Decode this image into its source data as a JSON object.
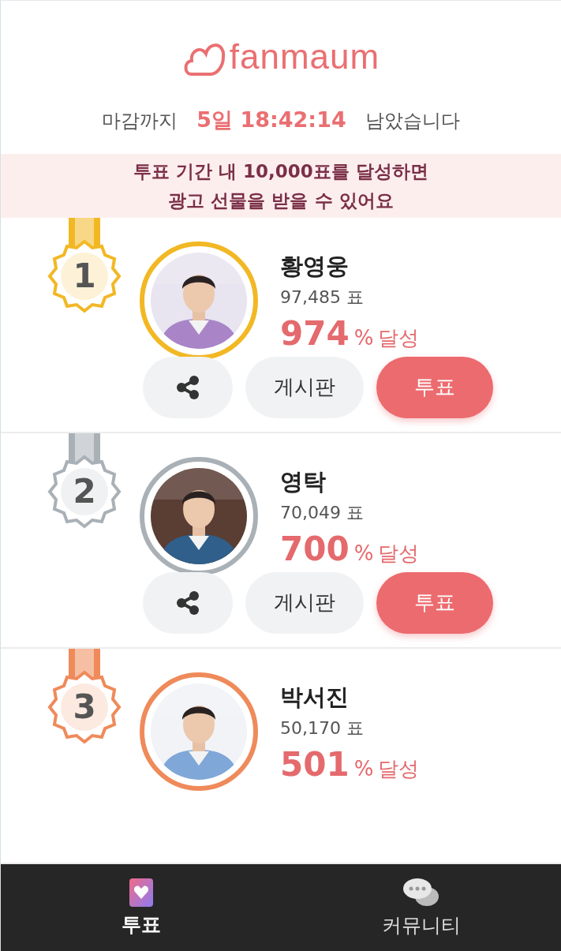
{
  "logo": {
    "text": "fanmaum"
  },
  "countdown": {
    "prefix": "마감까지",
    "time": "5일 18:42:14",
    "suffix": "남았습니다"
  },
  "banner": {
    "lines": [
      "투표 기간 내 10,000표를 달성하면",
      "광고 선물을 받을 수 있어요"
    ]
  },
  "candidates": [
    {
      "rank": "1",
      "color": "#f2b824",
      "name": "황영웅",
      "votes": "97,485 표",
      "percent": "974",
      "percent_unit": "%",
      "percent_label": "달성",
      "actions": [
        {
          "kind": "share"
        },
        {
          "kind": "board",
          "label": "게시판"
        },
        {
          "kind": "vote",
          "label": "투표"
        }
      ]
    },
    {
      "rank": "2",
      "color": "#a9b0b6",
      "name": "영탁",
      "votes": "70,049 표",
      "percent": "700",
      "percent_unit": "%",
      "percent_label": "달성",
      "actions": [
        {
          "kind": "share"
        },
        {
          "kind": "board",
          "label": "게시판"
        },
        {
          "kind": "vote",
          "label": "투표"
        }
      ]
    },
    {
      "rank": "3",
      "color": "#ef8a5a",
      "name": "박서진",
      "votes": "50,170 표",
      "percent": "501",
      "percent_unit": "%",
      "percent_label": "달성"
    }
  ],
  "nav": [
    {
      "label": "투표",
      "selected": true
    },
    {
      "label": "커뮤니티",
      "selected": false
    }
  ]
}
